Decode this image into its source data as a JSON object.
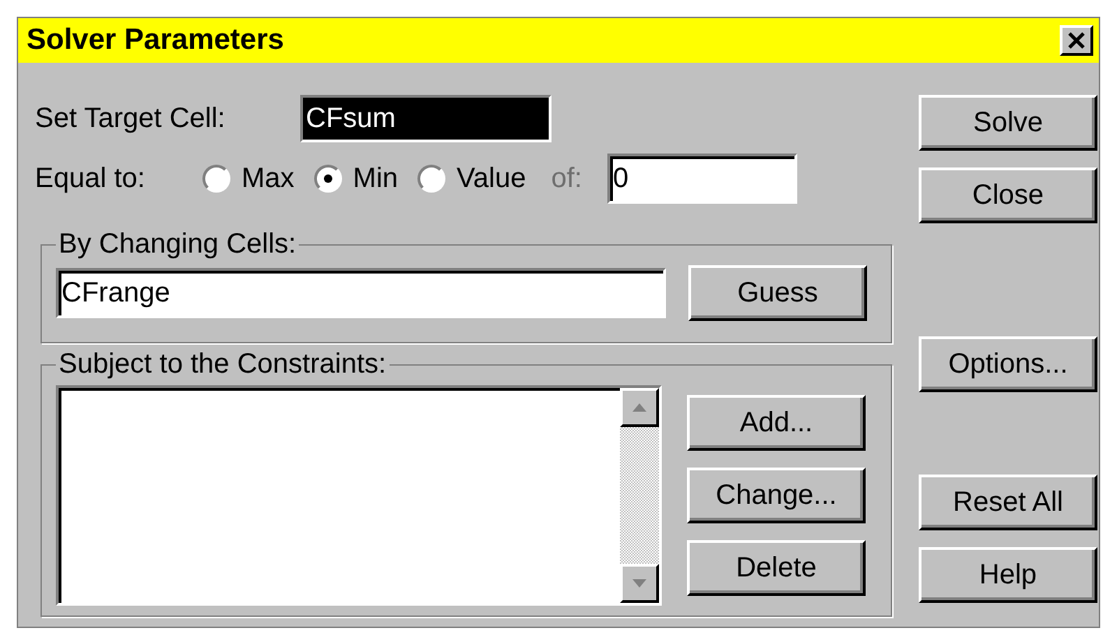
{
  "window": {
    "title": "Solver Parameters"
  },
  "target_cell": {
    "label": "Set Target Cell:",
    "value": "CFsum"
  },
  "equal_to": {
    "label": "Equal to:",
    "options": [
      {
        "label": "Max",
        "selected": false
      },
      {
        "label": "Min",
        "selected": true
      },
      {
        "label": "Value",
        "selected": false
      }
    ],
    "of_label": "of:",
    "of_disabled": true,
    "value": "0"
  },
  "changing_cells": {
    "label": "By Changing Cells:",
    "value": "CFrange",
    "button": {
      "label": "Guess"
    }
  },
  "constraints": {
    "label": "Subject to the Constraints:",
    "buttons": [
      {
        "label": "Add..."
      },
      {
        "label": "Change..."
      },
      {
        "label": "Delete"
      }
    ]
  },
  "side_buttons": [
    {
      "label": "Solve"
    },
    {
      "label": "Close"
    },
    {
      "label": "Options..."
    },
    {
      "label": "Reset All"
    },
    {
      "label": "Help"
    }
  ]
}
